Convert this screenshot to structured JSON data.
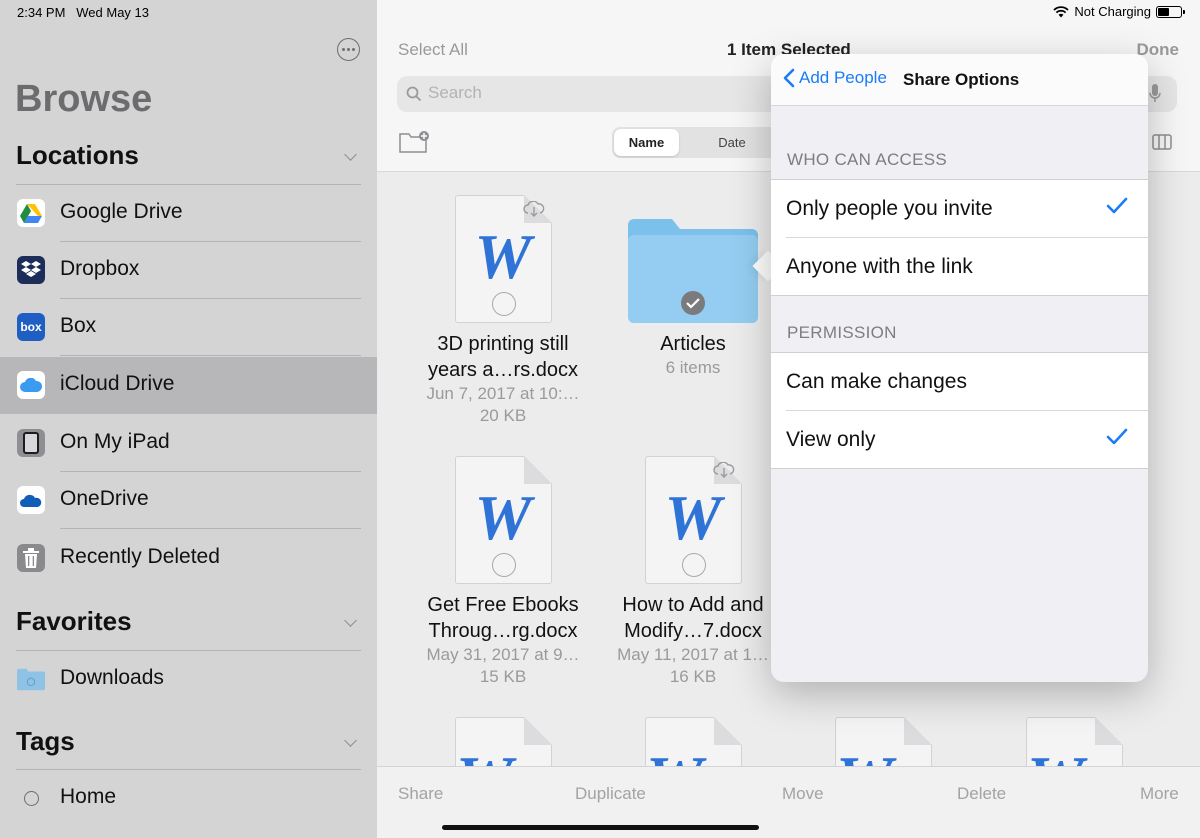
{
  "status": {
    "time": "2:34 PM",
    "date": "Wed May 13",
    "charging": "Not Charging",
    "battery_level": 0.45
  },
  "sidebar": {
    "title": "Browse",
    "locations_header": "Locations",
    "locations": [
      {
        "label": "Google Drive",
        "icon": "google-drive-icon"
      },
      {
        "label": "Dropbox",
        "icon": "dropbox-icon"
      },
      {
        "label": "Box",
        "icon": "box-icon",
        "icon_text": "box"
      },
      {
        "label": "iCloud Drive",
        "icon": "icloud-icon",
        "selected": true
      },
      {
        "label": "On My iPad",
        "icon": "ipad-icon"
      },
      {
        "label": "OneDrive",
        "icon": "onedrive-icon"
      },
      {
        "label": "Recently Deleted",
        "icon": "trash-icon"
      }
    ],
    "favorites_header": "Favorites",
    "favorites": [
      {
        "label": "Downloads",
        "icon": "downloads-folder-icon"
      }
    ],
    "tags_header": "Tags",
    "tags": [
      {
        "label": "Home",
        "icon": "tag-circle-icon"
      }
    ]
  },
  "header": {
    "select_all": "Select All",
    "title": "1 Item Selected",
    "done": "Done",
    "search_placeholder": "Search",
    "sort_name": "Name",
    "sort_date": "Date"
  },
  "files": [
    {
      "name1": "3D printing still",
      "name2": "years a…rs.docx",
      "date": "Jun 7, 2017 at 10:…",
      "size": "20 KB",
      "glyph": "W"
    },
    {
      "name1": "Articles",
      "count": "6 items",
      "type": "folder"
    },
    {
      "name1": "Get Free Ebooks",
      "name2": "Throug…rg.docx",
      "date": "May 31, 2017 at 9…",
      "size": "15 KB",
      "glyph": "W"
    },
    {
      "name1": "How to Add and",
      "name2": "Modify…7.docx",
      "date": "May 11, 2017 at 1…",
      "size": "16 KB",
      "glyph": "W"
    }
  ],
  "toolbar": {
    "share": "Share",
    "duplicate": "Duplicate",
    "move": "Move",
    "delete": "Delete",
    "more": "More"
  },
  "popover": {
    "back": "Add People",
    "title": "Share Options",
    "access_header": "WHO CAN ACCESS",
    "access_options": [
      {
        "label": "Only people you invite",
        "checked": true
      },
      {
        "label": "Anyone with the link",
        "checked": false
      }
    ],
    "permission_header": "PERMISSION",
    "permission_options": [
      {
        "label": "Can make changes",
        "checked": false
      },
      {
        "label": "View only",
        "checked": true
      }
    ]
  },
  "colors": {
    "accent": "#1a7cf6",
    "sidebar_bg": "#d4d4d5",
    "sidebar_selected": "#b7b7b9",
    "word_blue": "#2f73d6"
  }
}
